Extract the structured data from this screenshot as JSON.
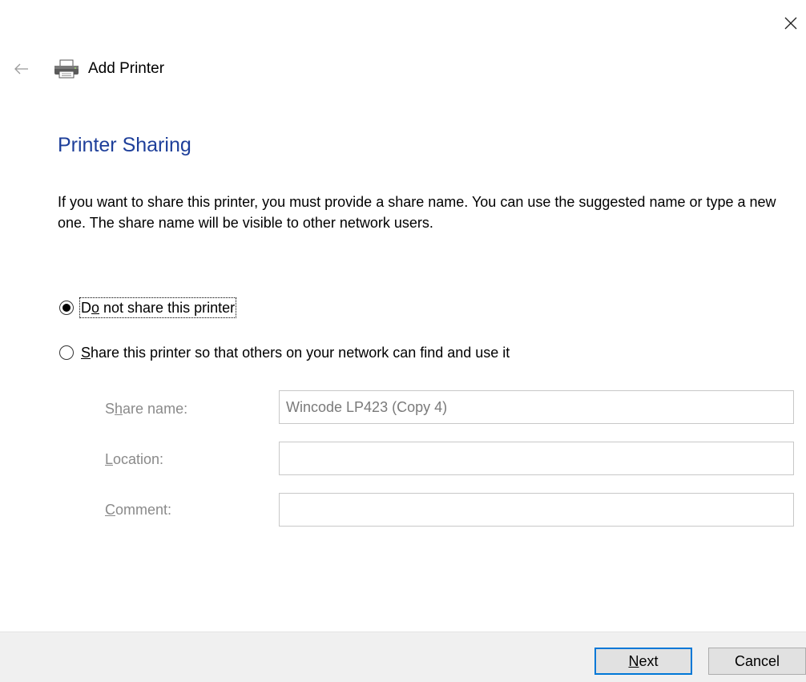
{
  "window": {
    "title": "Add Printer",
    "close_icon": "close-icon",
    "back_icon": "back-arrow-icon",
    "printer_icon": "printer-icon"
  },
  "page": {
    "heading": "Printer Sharing",
    "description": "If you want to share this printer, you must provide a share name. You can use the suggested name or type a new one. The share name will be visible to other network users."
  },
  "options": {
    "do_not_share": {
      "pre": "D",
      "accel": "o",
      "post": " not share this printer",
      "selected": true
    },
    "share": {
      "pre": "",
      "accel": "S",
      "post": "hare this printer so that others on your network can find and use it",
      "selected": false
    }
  },
  "fields": {
    "share_name": {
      "label_pre": "S",
      "label_accel": "h",
      "label_post": "are name:",
      "value": "Wincode LP423 (Copy 4)"
    },
    "location": {
      "label_pre": "",
      "label_accel": "L",
      "label_post": "ocation:",
      "value": ""
    },
    "comment": {
      "label_pre": "",
      "label_accel": "C",
      "label_post": "omment:",
      "value": ""
    }
  },
  "buttons": {
    "next_accel": "N",
    "next_post": "ext",
    "cancel": "Cancel"
  },
  "colors": {
    "heading": "#1e3f9a",
    "accent": "#0078d7",
    "disabled_text": "#8a8a8a",
    "footer_bg": "#f0f0f0"
  }
}
